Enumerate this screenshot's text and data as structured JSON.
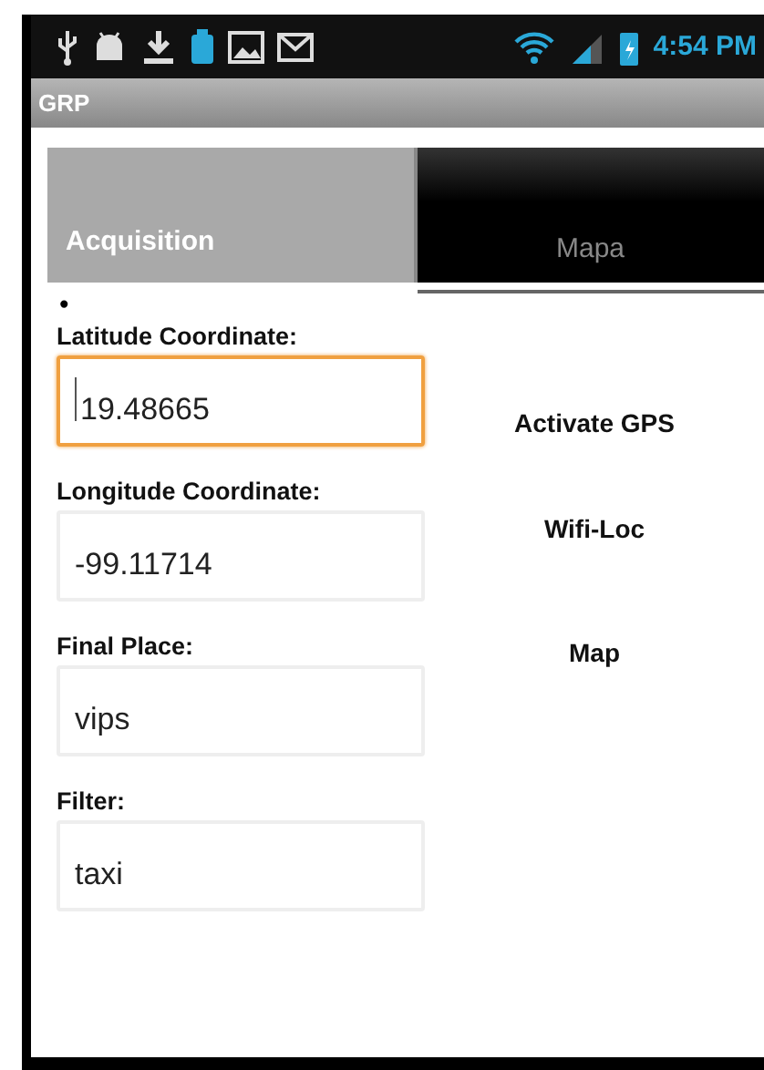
{
  "status_bar": {
    "time": "4:54 PM"
  },
  "window": {
    "title": "GRP"
  },
  "tabs": [
    {
      "label": "Acquisition",
      "selected": true
    },
    {
      "label": "Mapa",
      "selected": false
    }
  ],
  "bullet": "•",
  "fields": [
    {
      "label": "Latitude Coordinate:",
      "value": "19.48665",
      "focused": true
    },
    {
      "label": "Longitude Coordinate:",
      "value": "-99.11714",
      "focused": false
    },
    {
      "label": "Final Place:",
      "value": "vips",
      "focused": false
    },
    {
      "label": "Filter:",
      "value": "taxi",
      "focused": false
    }
  ],
  "buttons": [
    "Activate GPS",
    "Wifi-Loc",
    "Map"
  ]
}
